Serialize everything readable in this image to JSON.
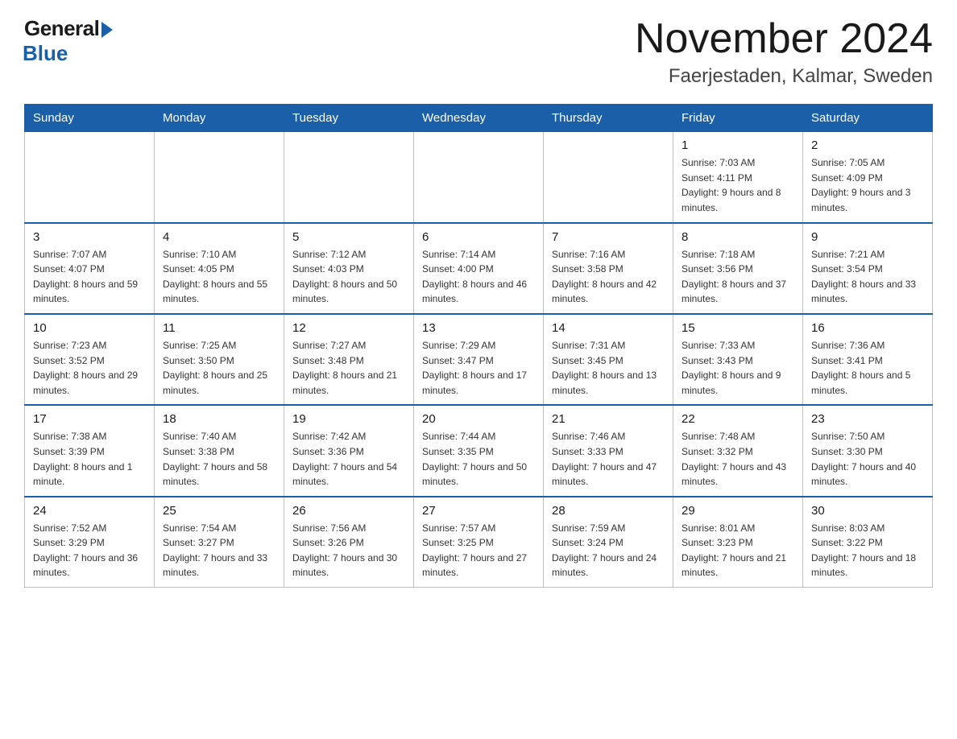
{
  "header": {
    "logo_general": "General",
    "logo_blue": "Blue",
    "title": "November 2024",
    "subtitle": "Faerjestaden, Kalmar, Sweden"
  },
  "days_of_week": [
    "Sunday",
    "Monday",
    "Tuesday",
    "Wednesday",
    "Thursday",
    "Friday",
    "Saturday"
  ],
  "weeks": [
    [
      {
        "day": "",
        "info": ""
      },
      {
        "day": "",
        "info": ""
      },
      {
        "day": "",
        "info": ""
      },
      {
        "day": "",
        "info": ""
      },
      {
        "day": "",
        "info": ""
      },
      {
        "day": "1",
        "info": "Sunrise: 7:03 AM\nSunset: 4:11 PM\nDaylight: 9 hours and 8 minutes."
      },
      {
        "day": "2",
        "info": "Sunrise: 7:05 AM\nSunset: 4:09 PM\nDaylight: 9 hours and 3 minutes."
      }
    ],
    [
      {
        "day": "3",
        "info": "Sunrise: 7:07 AM\nSunset: 4:07 PM\nDaylight: 8 hours and 59 minutes."
      },
      {
        "day": "4",
        "info": "Sunrise: 7:10 AM\nSunset: 4:05 PM\nDaylight: 8 hours and 55 minutes."
      },
      {
        "day": "5",
        "info": "Sunrise: 7:12 AM\nSunset: 4:03 PM\nDaylight: 8 hours and 50 minutes."
      },
      {
        "day": "6",
        "info": "Sunrise: 7:14 AM\nSunset: 4:00 PM\nDaylight: 8 hours and 46 minutes."
      },
      {
        "day": "7",
        "info": "Sunrise: 7:16 AM\nSunset: 3:58 PM\nDaylight: 8 hours and 42 minutes."
      },
      {
        "day": "8",
        "info": "Sunrise: 7:18 AM\nSunset: 3:56 PM\nDaylight: 8 hours and 37 minutes."
      },
      {
        "day": "9",
        "info": "Sunrise: 7:21 AM\nSunset: 3:54 PM\nDaylight: 8 hours and 33 minutes."
      }
    ],
    [
      {
        "day": "10",
        "info": "Sunrise: 7:23 AM\nSunset: 3:52 PM\nDaylight: 8 hours and 29 minutes."
      },
      {
        "day": "11",
        "info": "Sunrise: 7:25 AM\nSunset: 3:50 PM\nDaylight: 8 hours and 25 minutes."
      },
      {
        "day": "12",
        "info": "Sunrise: 7:27 AM\nSunset: 3:48 PM\nDaylight: 8 hours and 21 minutes."
      },
      {
        "day": "13",
        "info": "Sunrise: 7:29 AM\nSunset: 3:47 PM\nDaylight: 8 hours and 17 minutes."
      },
      {
        "day": "14",
        "info": "Sunrise: 7:31 AM\nSunset: 3:45 PM\nDaylight: 8 hours and 13 minutes."
      },
      {
        "day": "15",
        "info": "Sunrise: 7:33 AM\nSunset: 3:43 PM\nDaylight: 8 hours and 9 minutes."
      },
      {
        "day": "16",
        "info": "Sunrise: 7:36 AM\nSunset: 3:41 PM\nDaylight: 8 hours and 5 minutes."
      }
    ],
    [
      {
        "day": "17",
        "info": "Sunrise: 7:38 AM\nSunset: 3:39 PM\nDaylight: 8 hours and 1 minute."
      },
      {
        "day": "18",
        "info": "Sunrise: 7:40 AM\nSunset: 3:38 PM\nDaylight: 7 hours and 58 minutes."
      },
      {
        "day": "19",
        "info": "Sunrise: 7:42 AM\nSunset: 3:36 PM\nDaylight: 7 hours and 54 minutes."
      },
      {
        "day": "20",
        "info": "Sunrise: 7:44 AM\nSunset: 3:35 PM\nDaylight: 7 hours and 50 minutes."
      },
      {
        "day": "21",
        "info": "Sunrise: 7:46 AM\nSunset: 3:33 PM\nDaylight: 7 hours and 47 minutes."
      },
      {
        "day": "22",
        "info": "Sunrise: 7:48 AM\nSunset: 3:32 PM\nDaylight: 7 hours and 43 minutes."
      },
      {
        "day": "23",
        "info": "Sunrise: 7:50 AM\nSunset: 3:30 PM\nDaylight: 7 hours and 40 minutes."
      }
    ],
    [
      {
        "day": "24",
        "info": "Sunrise: 7:52 AM\nSunset: 3:29 PM\nDaylight: 7 hours and 36 minutes."
      },
      {
        "day": "25",
        "info": "Sunrise: 7:54 AM\nSunset: 3:27 PM\nDaylight: 7 hours and 33 minutes."
      },
      {
        "day": "26",
        "info": "Sunrise: 7:56 AM\nSunset: 3:26 PM\nDaylight: 7 hours and 30 minutes."
      },
      {
        "day": "27",
        "info": "Sunrise: 7:57 AM\nSunset: 3:25 PM\nDaylight: 7 hours and 27 minutes."
      },
      {
        "day": "28",
        "info": "Sunrise: 7:59 AM\nSunset: 3:24 PM\nDaylight: 7 hours and 24 minutes."
      },
      {
        "day": "29",
        "info": "Sunrise: 8:01 AM\nSunset: 3:23 PM\nDaylight: 7 hours and 21 minutes."
      },
      {
        "day": "30",
        "info": "Sunrise: 8:03 AM\nSunset: 3:22 PM\nDaylight: 7 hours and 18 minutes."
      }
    ]
  ]
}
